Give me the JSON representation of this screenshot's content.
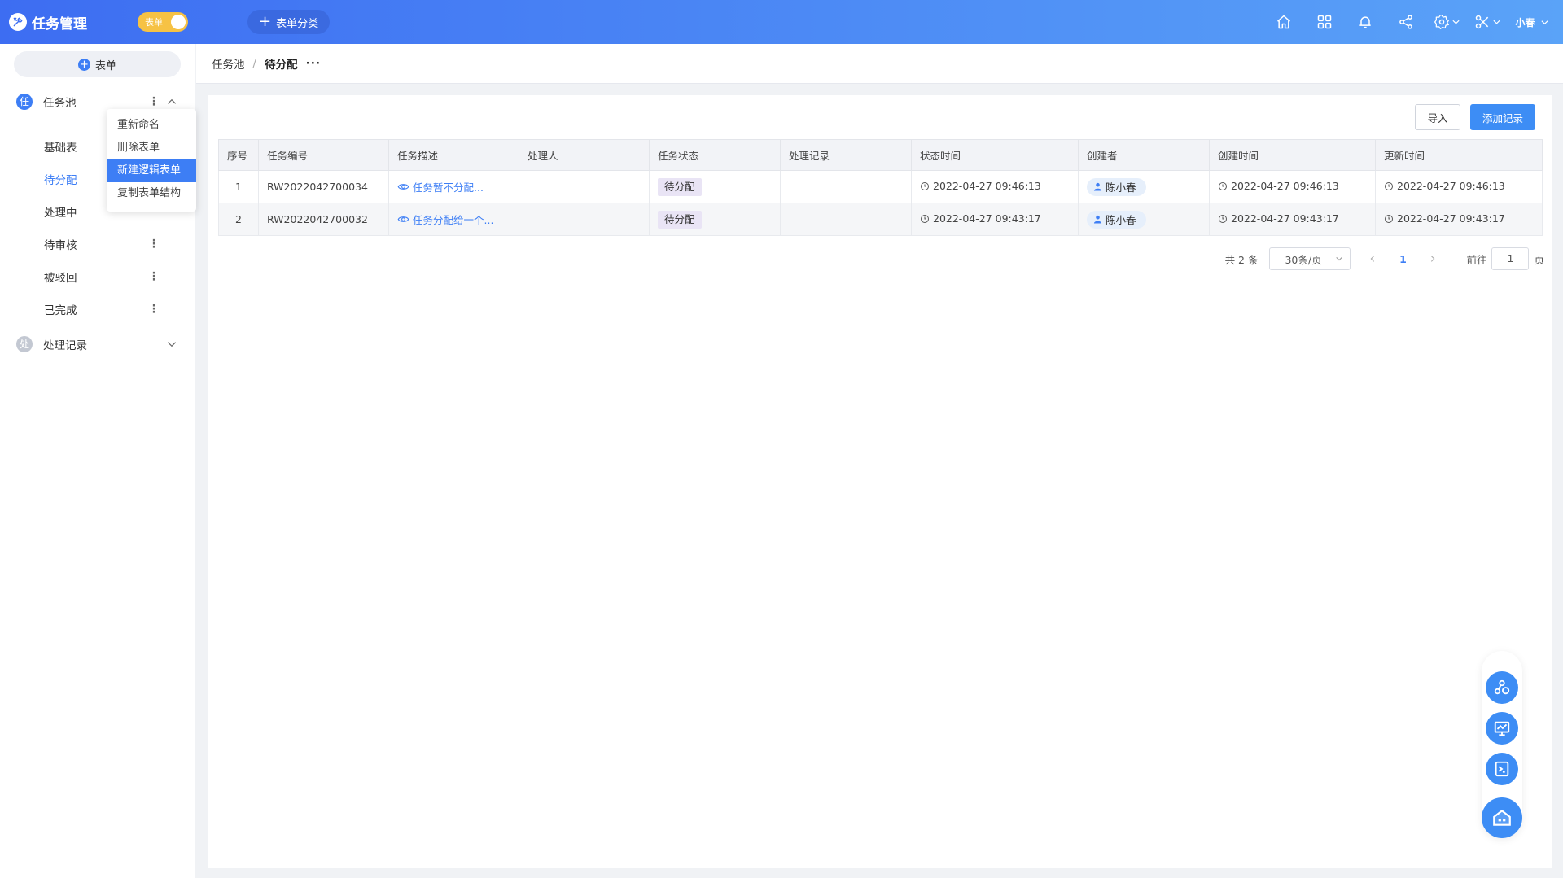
{
  "app": {
    "title": "任务管理",
    "mode_label": "表单",
    "category_button": "表单分类",
    "user_name": "小春"
  },
  "sidebar": {
    "add_form": "表单",
    "groups": [
      {
        "badge": "任",
        "label": "任务池"
      },
      {
        "badge": "处",
        "label": "处理记录"
      }
    ],
    "items": [
      "基础表",
      "待分配",
      "处理中",
      "待审核",
      "被驳回",
      "已完成"
    ]
  },
  "context_menu": {
    "items": [
      "重新命名",
      "删除表单",
      "新建逻辑表单",
      "复制表单结构"
    ],
    "selected_index": 2
  },
  "breadcrumb": {
    "parent": "任务池",
    "current": "待分配",
    "more": "···"
  },
  "toolbar": {
    "import_label": "导入",
    "add_label": "添加记录"
  },
  "table": {
    "columns": [
      "序号",
      "任务编号",
      "任务描述",
      "处理人",
      "任务状态",
      "处理记录",
      "状态时间",
      "创建者",
      "创建时间",
      "更新时间"
    ],
    "rows": [
      {
        "seq": "1",
        "id": "RW2022042700034",
        "desc": "任务暂不分配...",
        "handler": "",
        "status": "待分配",
        "record": "",
        "status_time": "2022-04-27 09:46:13",
        "creator": "陈小春",
        "created": "2022-04-27 09:46:13",
        "updated": "2022-04-27 09:46:13"
      },
      {
        "seq": "2",
        "id": "RW2022042700032",
        "desc": "任务分配给一个...",
        "handler": "",
        "status": "待分配",
        "record": "",
        "status_time": "2022-04-27 09:43:17",
        "creator": "陈小春",
        "created": "2022-04-27 09:43:17",
        "updated": "2022-04-27 09:43:17"
      }
    ]
  },
  "pagination": {
    "total": "共 2 条",
    "page_size": "30条/页",
    "current_page": "1",
    "goto_label": "前往",
    "goto_value": "1",
    "page_unit": "页"
  },
  "colors": {
    "primary": "#3d7ef5",
    "header_start": "#3d6df2",
    "header_end": "#5aa3f8",
    "toggle": "#f6c244"
  }
}
